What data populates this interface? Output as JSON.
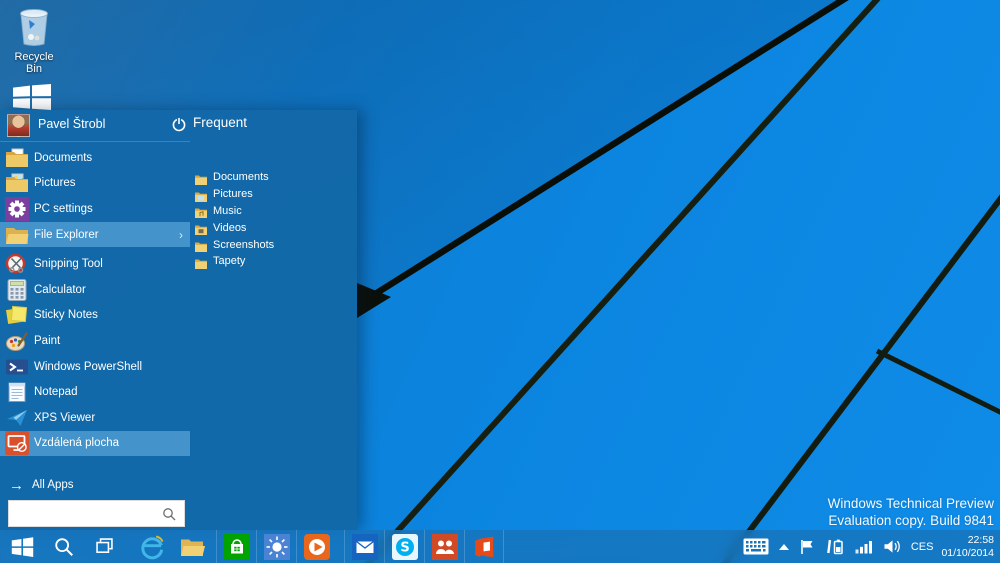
{
  "desktop": {
    "recycle_bin_label": "Recycle Bin",
    "watermark_line1": "Windows Technical Preview",
    "watermark_line2": "Evaluation copy. Build 9841"
  },
  "start_menu": {
    "user_name": "Pavel Štrobl",
    "frequent_header": "Frequent",
    "left_items": [
      {
        "label": "Documents",
        "icon": "documents-folder-icon",
        "highlighted": false
      },
      {
        "label": "Pictures",
        "icon": "pictures-folder-icon",
        "highlighted": false
      },
      {
        "label": "PC settings",
        "icon": "gear-icon",
        "highlighted": false
      },
      {
        "label": "File Explorer",
        "icon": "file-explorer-icon",
        "highlighted": true,
        "has_submenu": true
      },
      {
        "label": "Snipping Tool",
        "icon": "scissors-icon",
        "highlighted": false
      },
      {
        "label": "Calculator",
        "icon": "calculator-icon",
        "highlighted": false
      },
      {
        "label": "Sticky Notes",
        "icon": "sticky-notes-icon",
        "highlighted": false
      },
      {
        "label": "Paint",
        "icon": "paint-palette-icon",
        "highlighted": false
      },
      {
        "label": "Windows PowerShell",
        "icon": "powershell-icon",
        "highlighted": false
      },
      {
        "label": "Notepad",
        "icon": "notepad-icon",
        "highlighted": false
      },
      {
        "label": "XPS Viewer",
        "icon": "xps-viewer-icon",
        "highlighted": false
      },
      {
        "label": "Vzdálená plocha",
        "icon": "remote-desktop-icon",
        "highlighted": true
      }
    ],
    "submenu_arrow": "›",
    "frequent_items": [
      {
        "label": "Documents",
        "icon": "folder-icon"
      },
      {
        "label": "Pictures",
        "icon": "folder-icon"
      },
      {
        "label": "Music",
        "icon": "folder-icon"
      },
      {
        "label": "Videos",
        "icon": "folder-icon"
      },
      {
        "label": "Screenshots",
        "icon": "folder-icon"
      },
      {
        "label": "Tapety",
        "icon": "folder-icon"
      }
    ],
    "all_apps_label": "All Apps",
    "all_apps_arrow": "→",
    "search_value": ""
  },
  "taskbar": {
    "buttons": [
      "start-icon",
      "search-icon",
      "task-view-icon",
      "ie-icon",
      "explorer-folder-icon",
      "store-icon",
      "weather-icon",
      "media-player-icon",
      "mail-icon",
      "skype-icon",
      "people-icon",
      "office-icon"
    ],
    "tray": {
      "icons": [
        "touch-keyboard-icon",
        "chevron-up-icon",
        "action-center-flag-icon",
        "battery-icon",
        "network-icon",
        "volume-icon"
      ],
      "language": "CES",
      "time": "22:58",
      "date": "01/10/2014"
    }
  },
  "colors": {
    "desktop_blue": "#0d84dd",
    "menu_blue": "#1368a7",
    "highlight_blue": "#4493cb",
    "taskbar_blue": "#1a73b6",
    "wallpaper_line": "#111a0e"
  }
}
